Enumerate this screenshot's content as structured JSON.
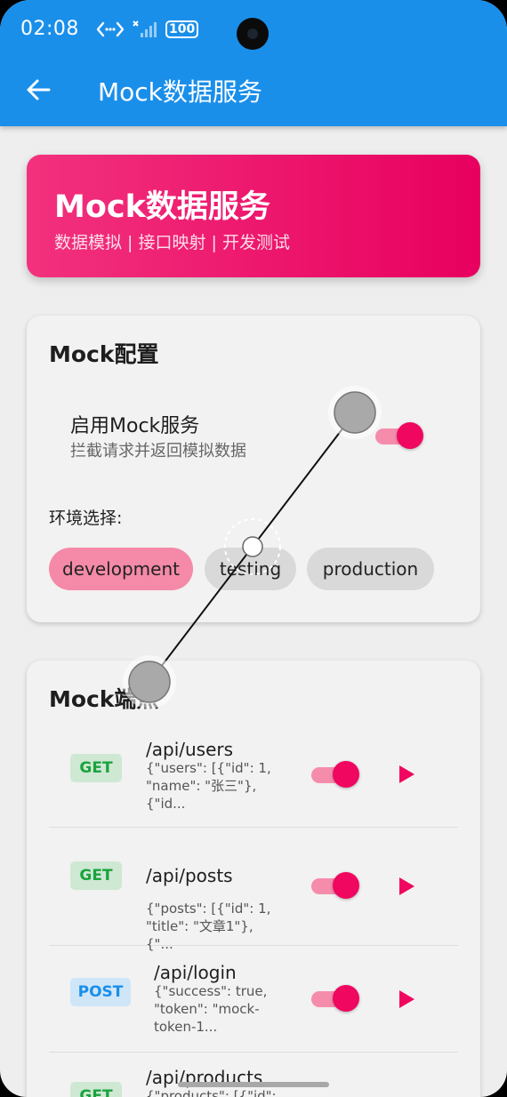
{
  "status_bar": {
    "time": "02:08",
    "battery": "100"
  },
  "appbar": {
    "title": "Mock数据服务"
  },
  "hero": {
    "title": "Mock数据服务",
    "subtitle": "数据模拟 | 接口映射 | 开发测试"
  },
  "config": {
    "title": "Mock配置",
    "enable_title": "启用Mock服务",
    "enable_subtitle": "拦截请求并返回模拟数据",
    "enabled": true,
    "env_label": "环境选择:",
    "environments": [
      "development",
      "testing",
      "production"
    ],
    "selected_env": "development"
  },
  "endpoints": {
    "title": "Mock端点",
    "items": [
      {
        "method": "GET",
        "path": "/api/users",
        "body": "{\"users\": [{\"id\": 1,\n\"name\": \"张三\"},\n{\"id...",
        "enabled": true
      },
      {
        "method": "GET",
        "path": "/api/posts",
        "body": "{\"posts\": [{\"id\": 1,\n\"title\": \"文章1\"}, {\"...",
        "enabled": true
      },
      {
        "method": "POST",
        "path": "/api/login",
        "body": "{\"success\": true,\n\"token\": \"mock-\ntoken-1...",
        "enabled": true
      },
      {
        "method": "GET",
        "path": "/api/products",
        "body": "{\"products\": [{\"id\":",
        "enabled": true
      }
    ]
  },
  "colors": {
    "appbar": "#1a8fea",
    "accent": "#f0075f",
    "hero_start": "#f2317d",
    "hero_end": "#e8005f",
    "get_badge": "#1aa33d",
    "post_badge": "#1a8fea"
  }
}
